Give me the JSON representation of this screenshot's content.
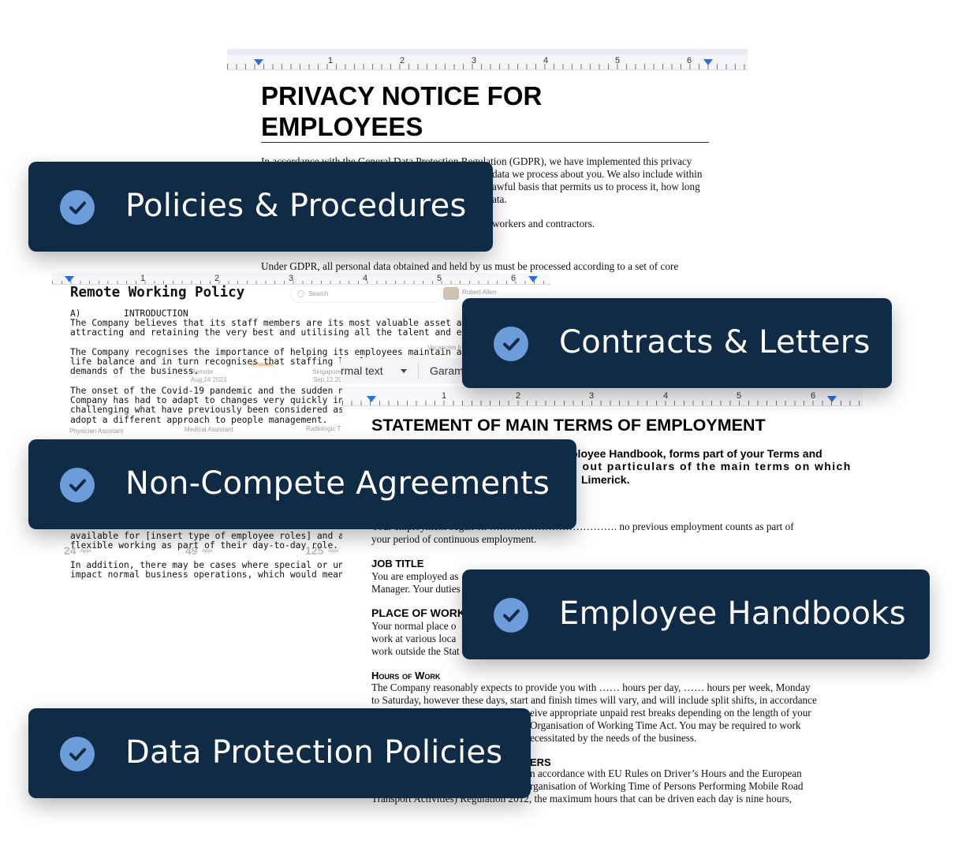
{
  "privacy_doc": {
    "ruler_numbers": [
      "1",
      "2",
      "3",
      "4",
      "5",
      "6"
    ],
    "title_line1": "PRIVACY NOTICE FOR",
    "title_line2": "EMPLOYEES",
    "p1_l1": "In accordance with the General Data Protection Regulation (GDPR), we have implemented this privacy",
    "p1_l2": "data we process about you. We also include within",
    "p1_l3": "awful basis that permits us to process it, how long",
    "p1_l4": "ata.",
    "p2": "workers and contractors.",
    "p3": "Under GDPR, all personal data obtained and held by us must be processed according to a set of core"
  },
  "remote_doc": {
    "ruler_numbers": [
      "1",
      "2",
      "3",
      "4",
      "5",
      "6"
    ],
    "title": "Remote Working Policy",
    "section": "A)        INTRODUCTION",
    "lines": [
      "The Company believes that its staff members are its most valuable asset and is comm",
      "attracting and retaining the very best and utilising all the talent and experience avai",
      "The Company recognises the importance of helping its employees maintain a good w",
      "life balance and in turn recognises that staffing levels must",
      "demands of the business.",
      "The onset of the Covid-19 pandemic and the sudden need f",
      "Company has had to adapt to changes very quickly in the w",
      "challenging what have previously been considered as ‘norm",
      "adopt a different approach to people management.",
      "available for [insert type of employee roles] and anyone w",
      "flexible working as part of their day-to-day role.",
      "In addition, there may be cases where special or unforesee",
      "impact normal business operations, which would mean that"
    ],
    "toolbar_style": "rmal text",
    "toolbar_font": "Garam",
    "faint_user": "Robert Allen",
    "faint_search": "Search",
    "faint_items": [
      "Physician Assistant",
      "Medical Assistant",
      "Radiologic T",
      "Aug,24 2023",
      "Sep,12 2023",
      "Remote",
      "Singapore",
      "Vacancies b",
      "In Review"
    ],
    "faint_counts": [
      "24",
      "49",
      "125"
    ],
    "faint_apps": "Apps"
  },
  "statement_doc": {
    "ruler_numbers": [
      "1",
      "2",
      "3",
      "4",
      "5",
      "6"
    ],
    "title": "STATEMENT OF MAIN TERMS OF EMPLOYMENT",
    "bold_l1": "ployee Handbook, forms part of your Terms and",
    "bold_l2": "s out particulars of the main terms on which",
    "bold_l3": "Limerick.",
    "employ_l1": "Your employment began on ………………………………. no previous employment counts as part of",
    "employ_l2": "your period of continuous employment.",
    "job_title_heading": "JOB TITLE",
    "job_l1": "You are employed as",
    "job_l2": "Manager. Your duties",
    "place_heading": "PLACE OF WORK",
    "place_l1": "Your normal place o",
    "place_l2": "work at various loca",
    "place_l3": "work outside the Stat",
    "hours_heading": "Hours of Work",
    "hours_l1": "The Company reasonably expects to provide you with …… hours per day, …… hours per week, Monday",
    "hours_l2": "to Saturday, however these days, start and finish times will vary, and will include split shifts, in accordance",
    "hours_l3": "eive appropriate unpaid rest breaks depending on the length of your",
    "hours_l4": "Organisation of Working Time Act.   You may be required to work",
    "hours_l5": "ecessitated by the needs of the business.",
    "drivers_heading": "ERS",
    "drivers_l1": "n accordance with EU Rules on Driver’s Hours and the European",
    "drivers_l2": "rganisation of Working Time of Persons Performing Mobile Road",
    "drivers_l3": "Transport Activities) Regulation 2012, the maximum hours that can be driven each day is nine hours,"
  },
  "badges": [
    {
      "label": "Policies & Procedures"
    },
    {
      "label": "Contracts & Letters"
    },
    {
      "label": "Non-Compete Agreements"
    },
    {
      "label": "Employee Handbooks"
    },
    {
      "label": "Data Protection Policies"
    }
  ],
  "colors": {
    "badge_bg": "#0f2b45",
    "check_circle": "#6c9cd9",
    "badge_text": "#ffffff",
    "ruler_marker": "#2f6fd8"
  },
  "icons": {
    "badge_icon": "check-circle-icon",
    "ruler_marker": "indent-marker-icon"
  }
}
